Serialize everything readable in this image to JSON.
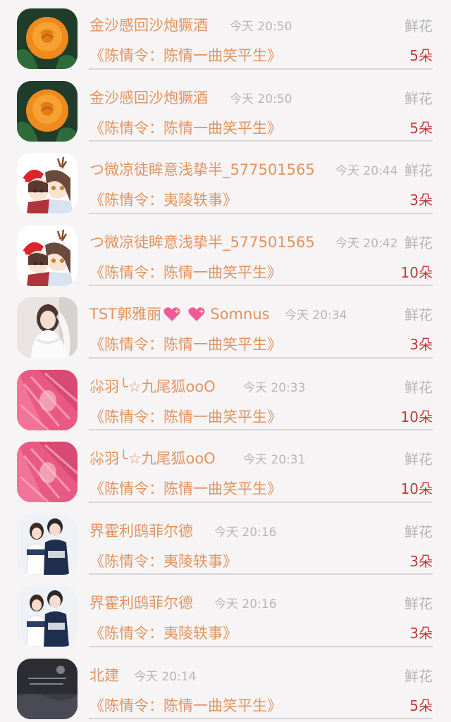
{
  "gifts": [
    {
      "name": "金沙感回沙炮獗酒",
      "time": "今天 20:50",
      "gift": "鲜花",
      "title": "《陈情令：陈情一曲笑平生》",
      "count": "5朵",
      "avatar": "rose-avatar"
    },
    {
      "name": "金沙感回沙炮獗酒",
      "time": "今天 20:50",
      "gift": "鲜花",
      "title": "《陈情令：陈情一曲笑平生》",
      "count": "5朵",
      "avatar": "rose-avatar"
    },
    {
      "name": "つ微凉徒眸意浅挚半_577501565",
      "time": "今天 20:44",
      "gift": "鲜花",
      "title": "《陈情令：夷陵轶事》",
      "count": "3朵",
      "avatar": "anime-avatar"
    },
    {
      "name": "つ微凉徒眸意浅挚半_577501565",
      "time": "今天 20:42",
      "gift": "鲜花",
      "title": "《陈情令：陈情一曲笑平生》",
      "count": "10朵",
      "avatar": "anime-avatar"
    },
    {
      "name": "TST郭雅丽",
      "name_suffix": "Somnus",
      "time": "今天 20:34",
      "gift": "鲜花",
      "title": "《陈情令：陈情一曲笑平生》",
      "count": "3朵",
      "avatar": "bride-avatar"
    },
    {
      "name": "尛羽╰☆九尾狐ooO",
      "time": "今天 20:33",
      "gift": "鲜花",
      "title": "《陈情令：陈情一曲笑平生》",
      "count": "10朵",
      "avatar": "pink-avatar"
    },
    {
      "name": "尛羽╰☆九尾狐ooO",
      "time": "今天 20:31",
      "gift": "鲜花",
      "title": "《陈情令：陈情一曲笑平生》",
      "count": "10朵",
      "avatar": "pink-avatar"
    },
    {
      "name": "界霍利鸱菲尔德",
      "time": "今天 20:16",
      "gift": "鲜花",
      "title": "《陈情令：夷陵轶事》",
      "count": "3朵",
      "avatar": "couple-avatar"
    },
    {
      "name": "界霍利鸱菲尔德",
      "time": "今天 20:16",
      "gift": "鲜花",
      "title": "《陈情令：夷陵轶事》",
      "count": "3朵",
      "avatar": "couple-avatar"
    },
    {
      "name": "北建",
      "time": "今天 20:14",
      "gift": "鲜花",
      "title": "《陈情令：陈情一曲笑平生》",
      "count": "5朵",
      "avatar": "dark-avatar"
    }
  ],
  "colors": {
    "name": "#e2935e",
    "muted": "#b8b5b6",
    "count": "#c3363c",
    "background": "#f7f4f5"
  }
}
